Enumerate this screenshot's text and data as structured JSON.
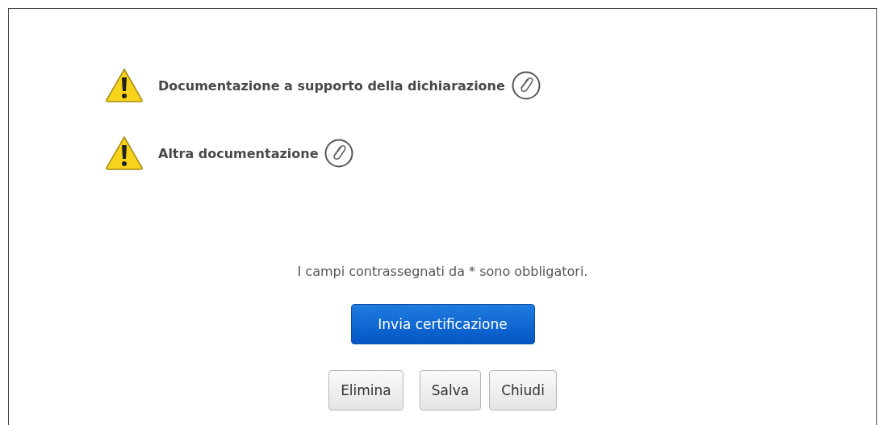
{
  "documents": [
    {
      "label": "Documentazione a supporto della dichiarazione",
      "kind": "warning"
    },
    {
      "label": "Altra documentazione",
      "kind": "warning"
    }
  ],
  "note": "I campi contrassegnati da * sono obbligatori.",
  "primary_button": "Invia certificazione",
  "buttons": [
    "Elimina",
    "Salva",
    "Chiudi"
  ]
}
